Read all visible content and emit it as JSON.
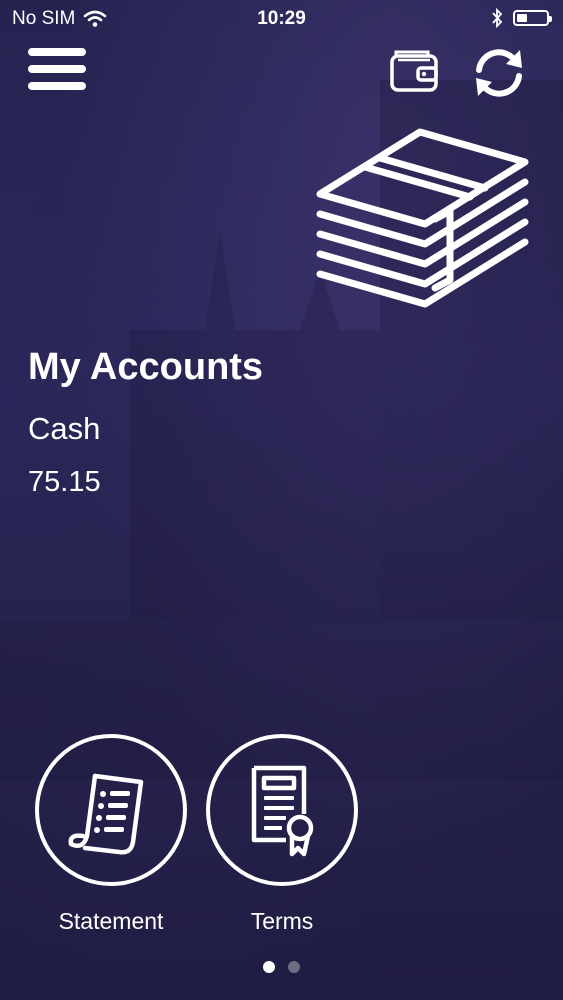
{
  "status_bar": {
    "carrier": "No SIM",
    "time": "10:29",
    "battery_level": 0.35
  },
  "header": {
    "icons": [
      "menu-icon",
      "wallet-icon",
      "refresh-icon"
    ]
  },
  "accounts": {
    "title": "My Accounts",
    "items": [
      {
        "name": "Cash",
        "balance": "75.15"
      }
    ]
  },
  "actions": [
    {
      "label": "Statement",
      "icon": "statement-receipt-icon"
    },
    {
      "label": "Terms",
      "icon": "certificate-icon"
    }
  ],
  "pagination": {
    "pages": 2,
    "current": 1
  },
  "colors": {
    "background": "#2a275a",
    "foreground": "#ffffff"
  }
}
